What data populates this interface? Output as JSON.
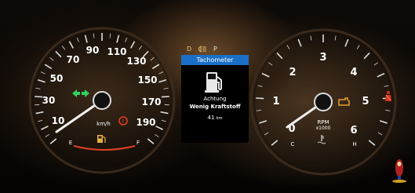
{
  "speedometer": {
    "ticks": [
      "10",
      "30",
      "50",
      "70",
      "90",
      "110",
      "130",
      "150",
      "170",
      "190"
    ],
    "unit": "km/h",
    "fuel_empty": "E",
    "fuel_full": "F"
  },
  "tachometer": {
    "ticks": [
      "0",
      "1",
      "2",
      "3",
      "4",
      "5",
      "6"
    ],
    "unit_line1": "RPM",
    "unit_line2": "x1000",
    "temp_cold": "C",
    "temp_hot": "H"
  },
  "center_display": {
    "gear_indicator": "D",
    "park_indicator": "P",
    "header": "Tachometer",
    "warning_line1": "Achtung",
    "warning_line2": "Wenig Kraftstoff",
    "range_value": "41",
    "range_unit": "km"
  },
  "colors": {
    "amber": "#e8b040",
    "red_warning": "#e04020",
    "green_indicator": "#30d060",
    "blue_header": "#1a6fc7"
  },
  "icons": [
    "turn-signal-icon",
    "brake-warning-icon",
    "low-fuel-icon",
    "fuel-pump-icon",
    "check-engine-icon",
    "coolant-temp-icon",
    "seatbelt-icon",
    "headlight-icon"
  ]
}
